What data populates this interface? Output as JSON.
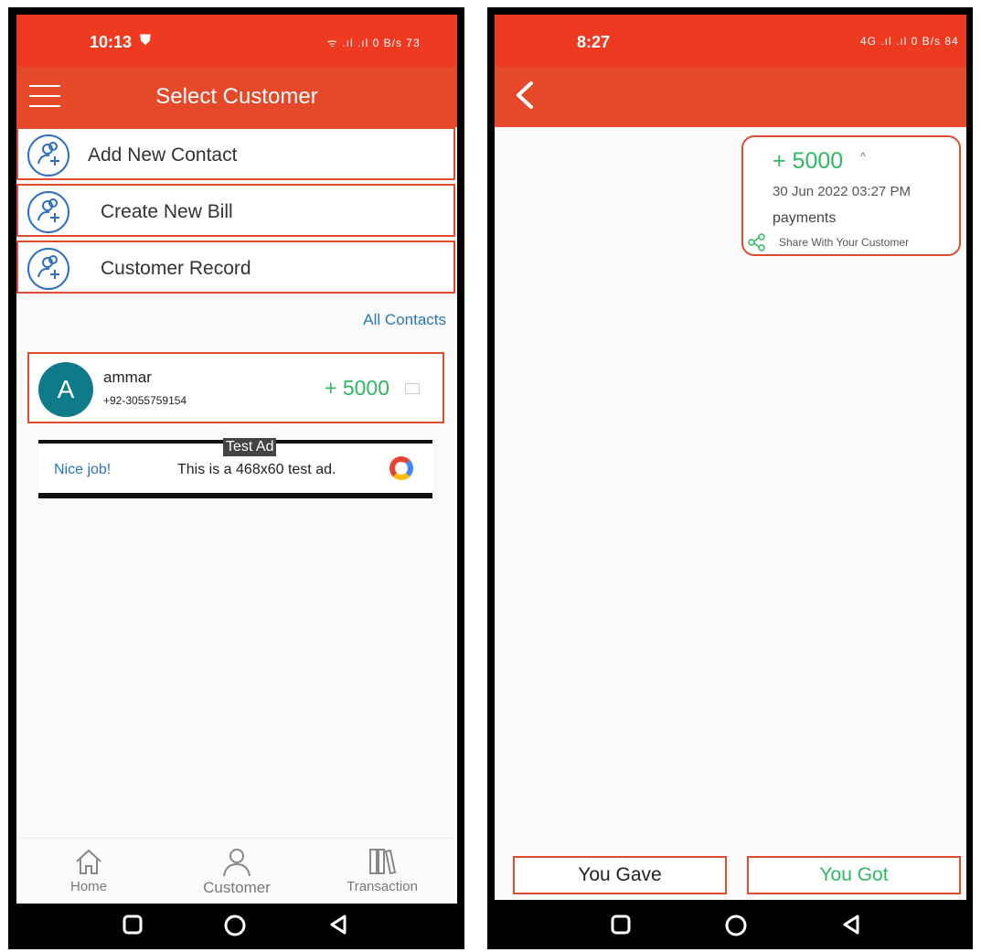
{
  "left_screen": {
    "status_bar": {
      "time": "10:13",
      "icons": "ᯤ .ıl .ıl 0 B/s 73"
    },
    "app_bar": {
      "title": "Select Customer"
    },
    "menu": [
      {
        "label": "Add New Contact"
      },
      {
        "label": "Create New Bill"
      },
      {
        "label": "Customer Record"
      }
    ],
    "all_contacts_link": "All Contacts",
    "customer": {
      "initial": "A",
      "name": "ammar",
      "phone": "+92-3055759154",
      "amount": "+ 5000"
    },
    "ad": {
      "tag": "Test Ad",
      "headline": "Nice job!",
      "text": "This is a 468x60 test ad."
    },
    "bottom_nav": [
      {
        "label": "Home",
        "icon": "home-icon"
      },
      {
        "label": "Customer",
        "icon": "person-icon"
      },
      {
        "label": "Transaction",
        "icon": "books-icon"
      }
    ]
  },
  "right_screen": {
    "status_bar": {
      "time": "8:27",
      "icons": "4G .ıl .ıl 0 B/s 84"
    },
    "entry": {
      "amount": "+ 5000",
      "date": "30 Jun 2022 03:27 PM",
      "note": "payments",
      "share_label": "Share With Your Customer"
    },
    "buttons": {
      "gave": "You Gave",
      "got": "You Got"
    }
  },
  "colors": {
    "status_bar": "#ee3a20",
    "app_bar": "#e5492a",
    "border": "#e14b30",
    "positive": "#2fb865",
    "link": "#2a77b8",
    "avatar": "#0f7a8a"
  }
}
